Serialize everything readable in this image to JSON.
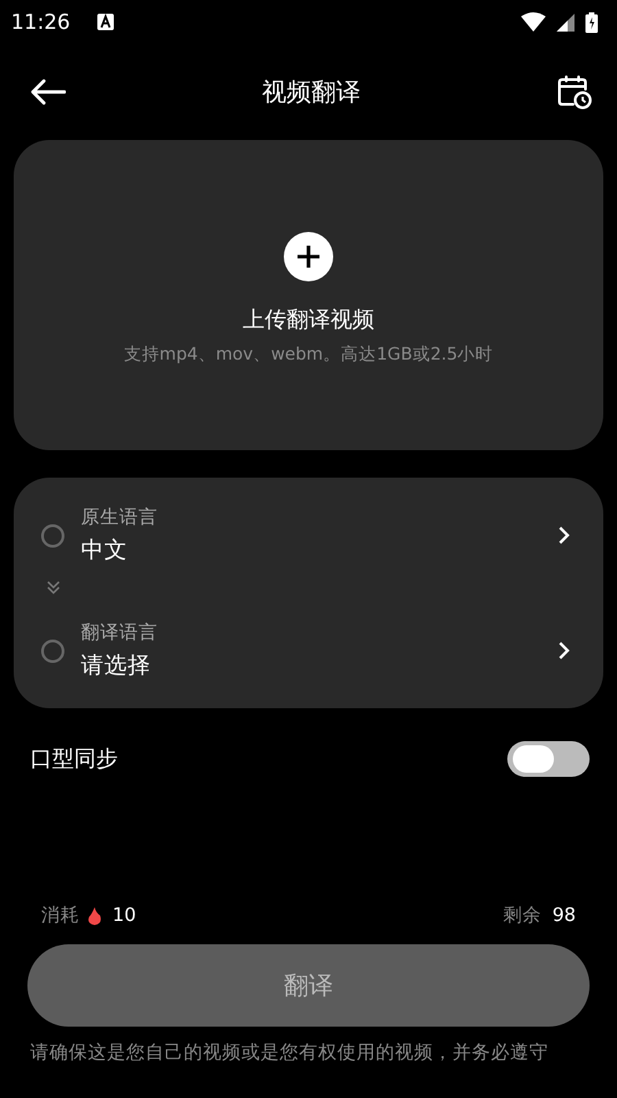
{
  "status_bar": {
    "time": "11:26"
  },
  "header": {
    "title": "视频翻译"
  },
  "upload": {
    "title": "上传翻译视频",
    "hint": "支持mp4、mov、webm。高达1GB或2.5小时"
  },
  "languages": [
    {
      "label": "原生语言",
      "value": "中文",
      "selected": false
    },
    {
      "label": "翻译语言",
      "value": "请选择",
      "selected": false
    }
  ],
  "lip_sync": {
    "label": "口型同步",
    "on": false
  },
  "cost": {
    "label": "消耗",
    "value": "10"
  },
  "remaining": {
    "label": "剩余",
    "value": "98"
  },
  "translate_button": "翻译",
  "notice": "请确保这是您自己的视频或是您有权使用的视频，并务必遵守"
}
